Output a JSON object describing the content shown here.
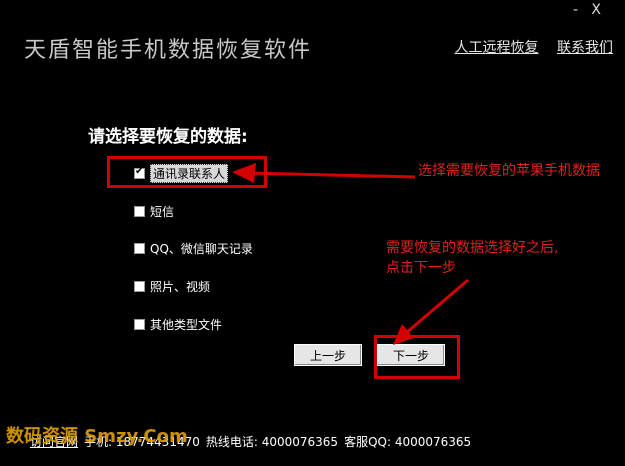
{
  "window": {
    "minimize": "-",
    "close": "X"
  },
  "header": {
    "title": "天盾智能手机数据恢复软件",
    "links": [
      "人工远程恢复",
      "联系我们"
    ]
  },
  "main": {
    "prompt": "请选择要恢复的数据:",
    "options": [
      {
        "label": "通讯录联系人",
        "checked": true
      },
      {
        "label": "短信",
        "checked": false
      },
      {
        "label": "QQ、微信聊天记录",
        "checked": false
      },
      {
        "label": "照片、视频",
        "checked": false
      },
      {
        "label": "其他类型文件",
        "checked": false
      }
    ],
    "buttons": {
      "prev": "上一步",
      "next": "下一步"
    }
  },
  "annotations": {
    "select": "选择需要恢复的苹果手机数据",
    "next": "需要恢复的数据选择好之后,点击下一步"
  },
  "footer": {
    "website": "访问官网",
    "phone": "手机: 18774431470",
    "hotline": "热线电话: 4000076365",
    "qq": "客服QQ: 4000076365"
  },
  "watermark": "数码资源 Smzy.Com",
  "colors": {
    "background": "#000000",
    "annotation": "#e02020"
  }
}
